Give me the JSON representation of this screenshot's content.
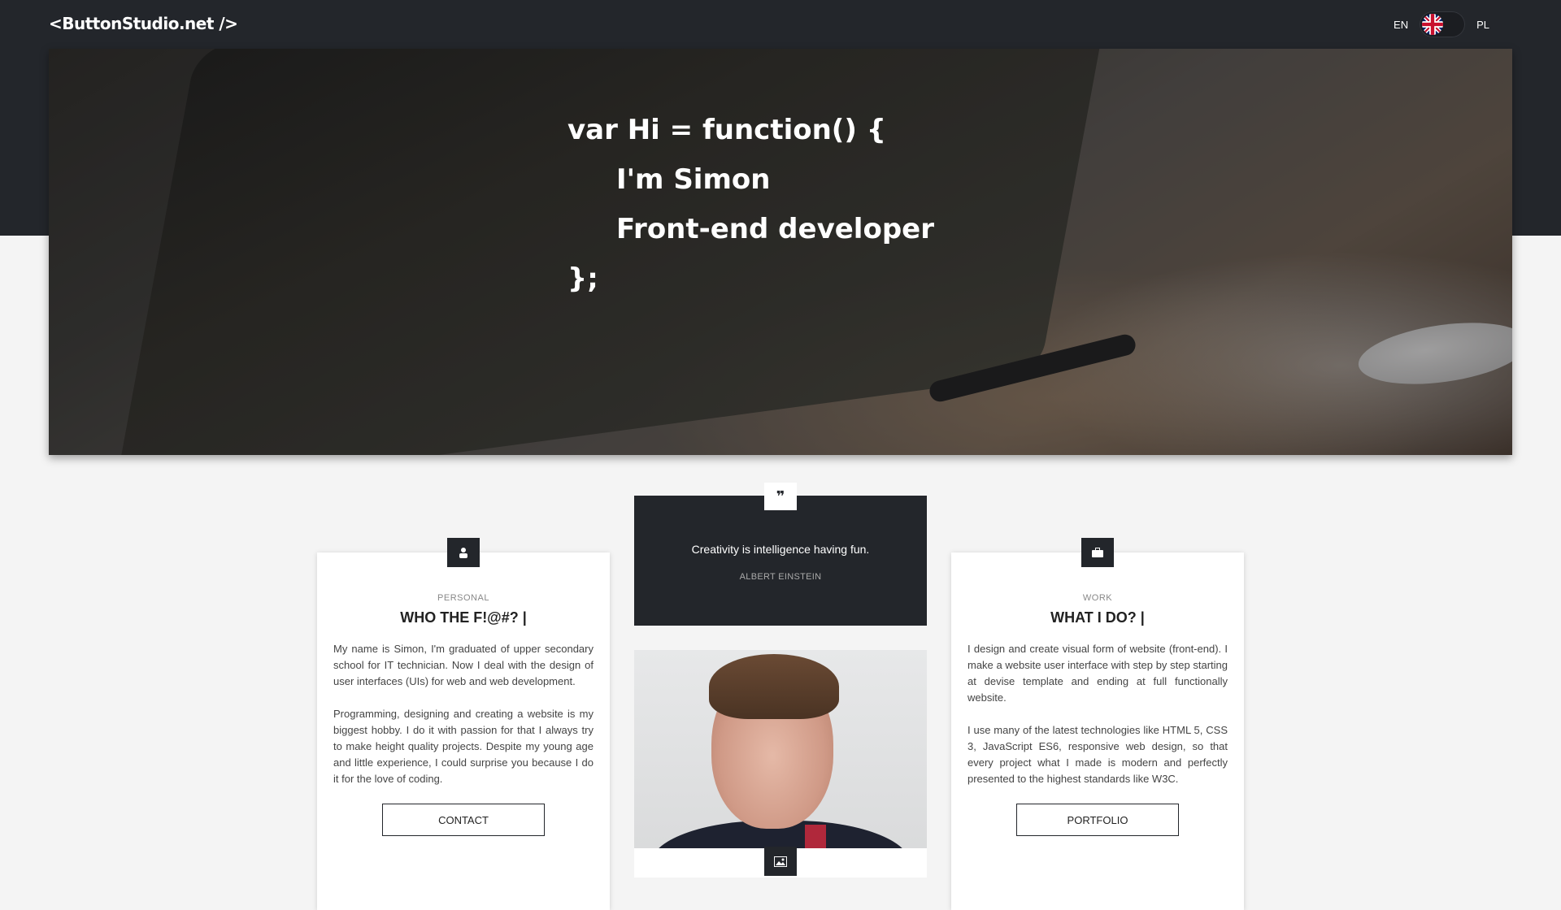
{
  "brand": {
    "logo": "<ButtonStudio.net />"
  },
  "language": {
    "left": "EN",
    "right": "PL"
  },
  "hero": {
    "line1": "var Hi = function() {",
    "line2": "I'm Simon",
    "line3": "Front-end developer",
    "line4": "};"
  },
  "quote": {
    "text": "Creativity is intelligence having fun.",
    "author": "ALBERT EINSTEIN"
  },
  "cards": [
    {
      "category": "PERSONAL",
      "title": "WHO THE F!@#? |",
      "paragraph1": "My name is Simon, I'm graduated of upper secondary school for IT technician. Now I deal with the design of user interfaces (UIs) for web and web development.",
      "paragraph2": "Programming, designing and creating a website is my biggest hobby. I do it with passion for that I always try to make height quality projects. Despite my young age and little experience, I could surprise you because I do it for the love of coding.",
      "button": "CONTACT"
    },
    {
      "category": "WORK",
      "title": "WHAT I DO? |",
      "paragraph1": "I design and create visual form of website (front-end). I make a website user interface with step by step starting at devise template and ending at full functionally website.",
      "paragraph2": "I use many of the latest technologies like HTML 5, CSS 3, JavaScript ES6, responsive web design, so that every project what I made is modern and perfectly presented to the highest standards like W3C.",
      "button": "PORTFOLIO"
    }
  ]
}
